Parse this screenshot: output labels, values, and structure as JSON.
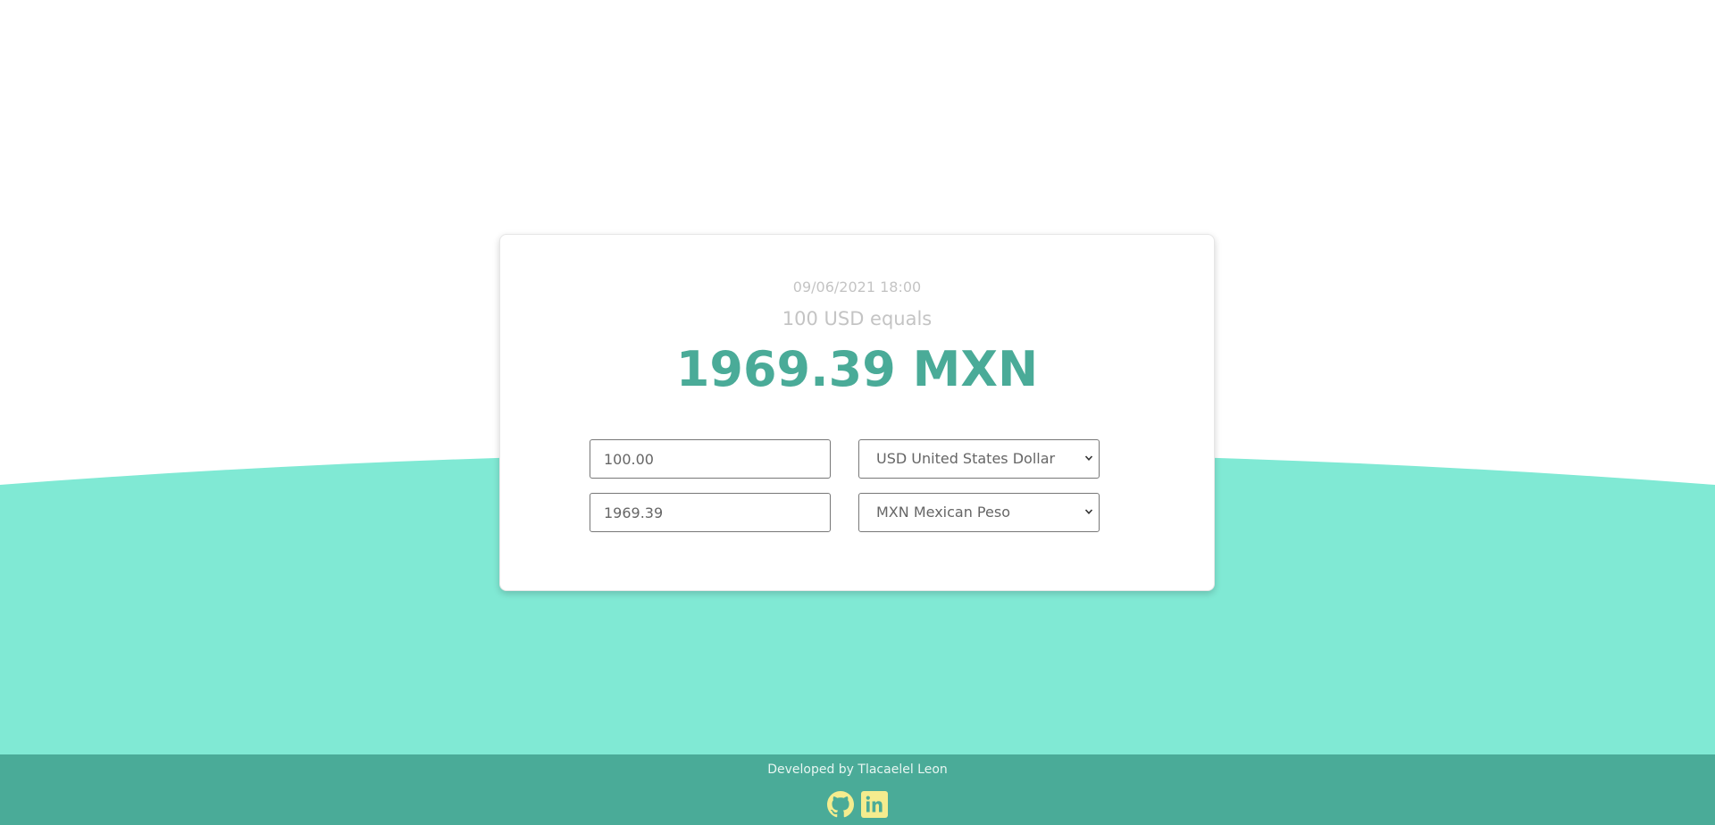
{
  "converter": {
    "timestamp": "09/06/2021 18:00",
    "equals_text": "100 USD equals",
    "result_text": "1969.39 MXN",
    "from": {
      "amount": "100.00",
      "currency_selected": "USD United States Dollar"
    },
    "to": {
      "amount": "1969.39",
      "currency_selected": "MXN Mexican Peso"
    }
  },
  "footer": {
    "credit": "Developed by Tlacaelel Leon",
    "icons": [
      "github-icon",
      "linkedin-icon"
    ]
  },
  "colors": {
    "accent": "#4aab98",
    "wave": "#80e9d4",
    "muted_text": "#c4c4c4",
    "icon_yellow": "#f4ec8e"
  }
}
